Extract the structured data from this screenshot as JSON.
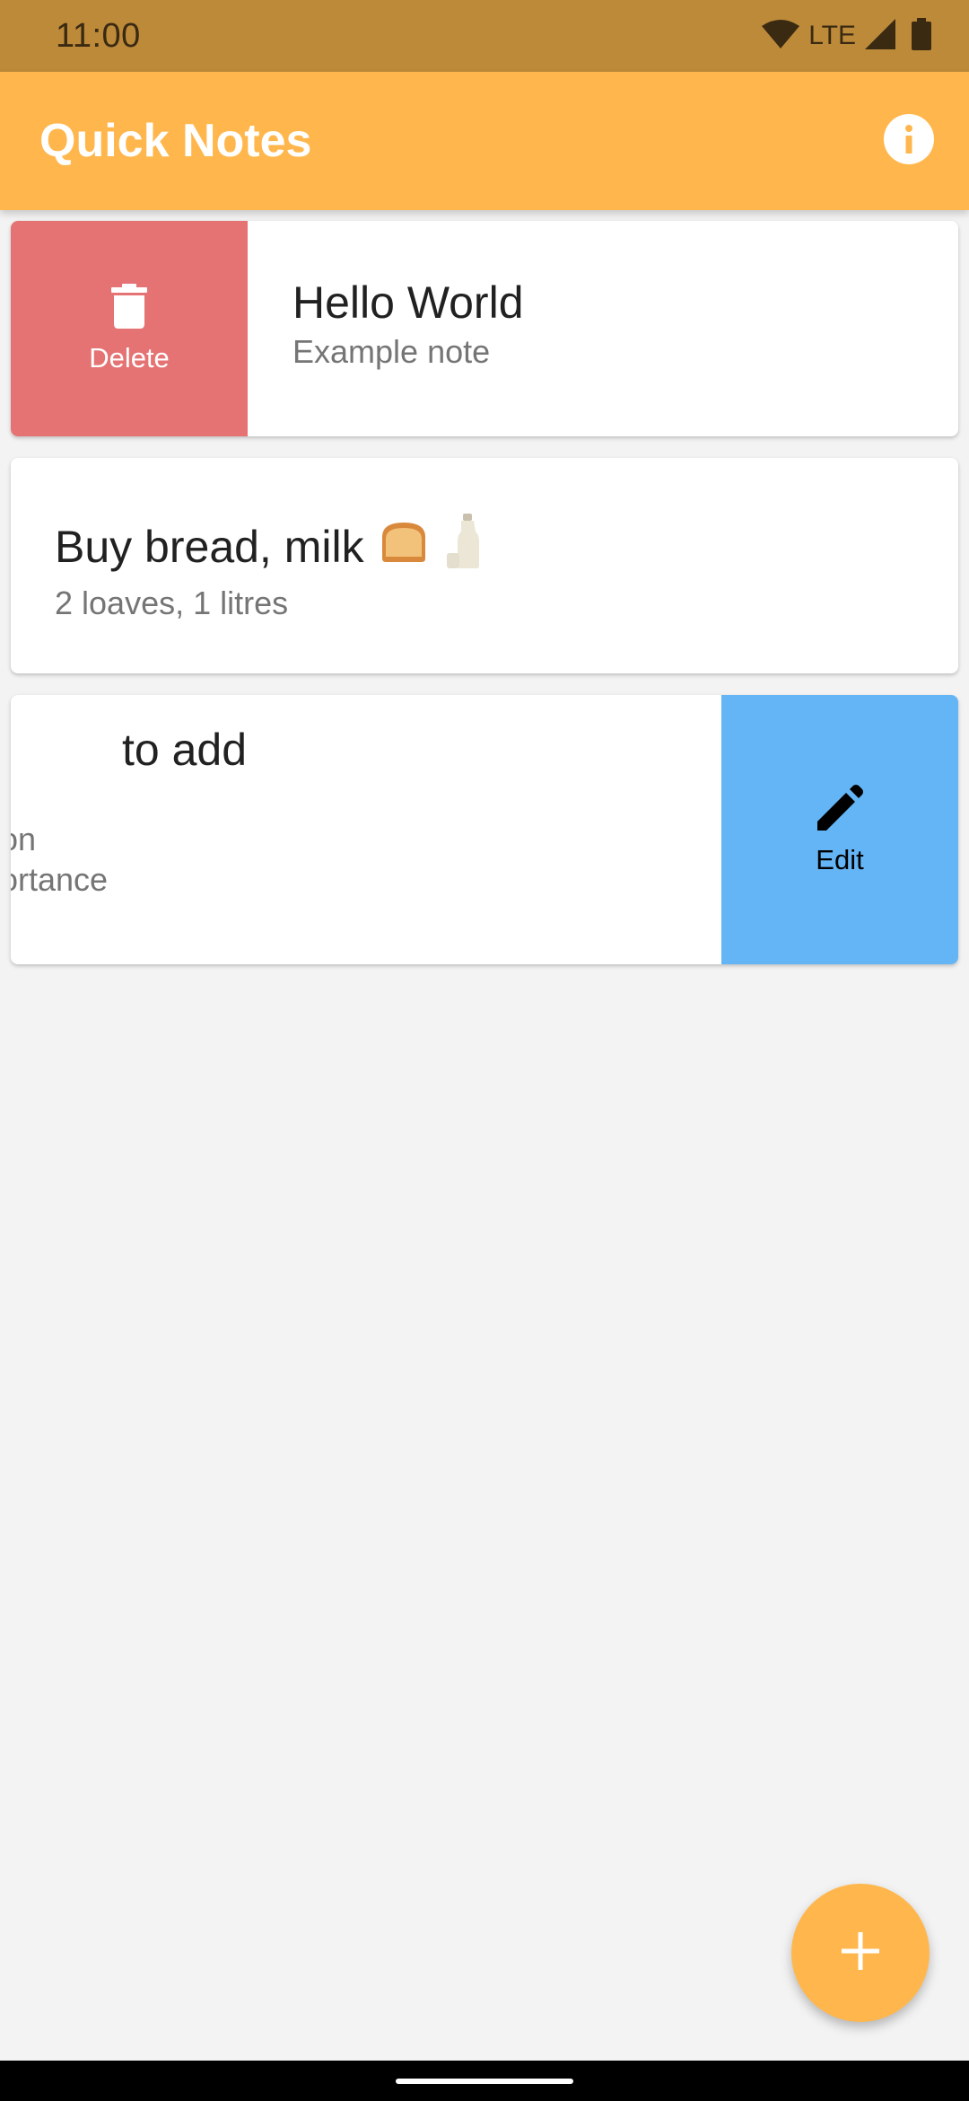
{
  "status_bar": {
    "time": "11:00",
    "network": "LTE",
    "icons": [
      "wifi-icon",
      "signal-icon",
      "battery-icon"
    ]
  },
  "app_bar": {
    "title": "Quick Notes",
    "info_icon": "info-icon"
  },
  "notes": [
    {
      "title": "Hello World",
      "subtitle": "Example note",
      "revealed_action": {
        "label": "Delete",
        "icon": "trash-icon",
        "color": "#e57373"
      }
    },
    {
      "title": "Buy bread, milk",
      "emoji": [
        "bread-icon",
        "milk-bottle-icon"
      ],
      "subtitle": "2 loaves, 1 litres"
    },
    {
      "title_visible_fragment": "to add",
      "subtitle_line_1_fragment": "on",
      "subtitle_line_2_fragment": "ortance",
      "revealed_action": {
        "label": "Edit",
        "icon": "pencil-icon",
        "color": "#64b5f6"
      }
    }
  ],
  "fab": {
    "icon": "plus-icon",
    "color": "#ffb74d"
  },
  "colors": {
    "accent": "#ffb74d",
    "status_bar": "#bd8a3a",
    "background": "#f3f3f3"
  }
}
